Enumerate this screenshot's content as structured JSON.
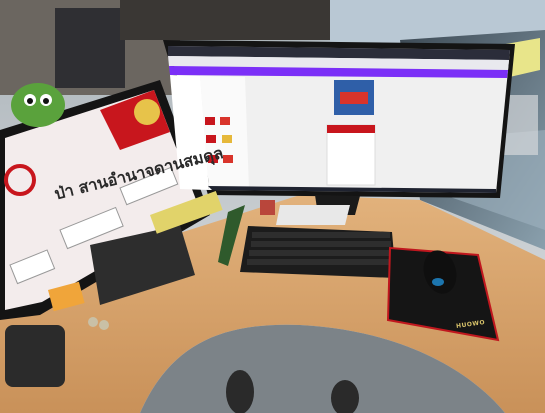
{
  "scene": {
    "description_visible_text": {
      "left_slide_title": "ป่า สานอำนาจดานสมดุล",
      "mousepad_brand": "HUOWO"
    },
    "colors": {
      "desk": "#d9a56a",
      "desk_edge": "#c28a52",
      "monitor_bezel": "#141414",
      "canva_bg": "#f0f0f0",
      "browser_bar": "#2b2d3a",
      "keyboard": "#1c1c1c",
      "mousepad": "#151515",
      "mousepad_edge": "#c0171e",
      "slide_red": "#c8161d",
      "slide_bg": "#f3ecec"
    }
  }
}
